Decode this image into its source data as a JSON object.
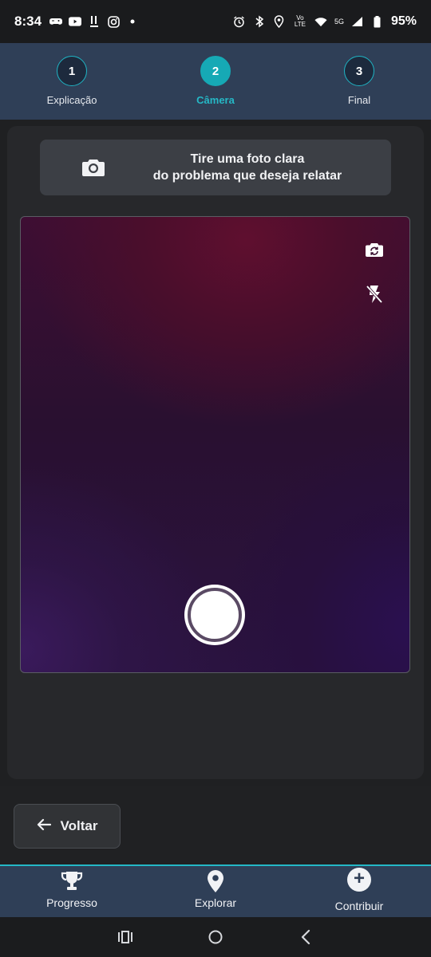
{
  "status_bar": {
    "time": "8:34",
    "network": "5G",
    "lte": "Vo LTE",
    "battery": "95%"
  },
  "stepper": {
    "steps": [
      {
        "number": "1",
        "label": "Explicação"
      },
      {
        "number": "2",
        "label": "Câmera"
      },
      {
        "number": "3",
        "label": "Final"
      }
    ],
    "active_index": 1,
    "accent_color": "#16a9b5"
  },
  "instruction": {
    "line1": "Tire uma foto clara",
    "line2": "do problema que deseja relatar",
    "icon": "camera-icon"
  },
  "camera": {
    "flip_icon": "camera-flip-icon",
    "flash_icon": "flash-off-icon"
  },
  "back_button": {
    "label": "Voltar",
    "icon": "arrow-left-icon"
  },
  "bottom_nav": {
    "items": [
      {
        "label": "Progresso",
        "icon": "trophy-icon"
      },
      {
        "label": "Explorar",
        "icon": "map-pin-icon"
      },
      {
        "label": "Contribuir",
        "icon": "plus-circle-icon"
      }
    ]
  },
  "system_nav": {
    "buttons": [
      "recents-icon",
      "home-icon",
      "back-icon"
    ]
  }
}
